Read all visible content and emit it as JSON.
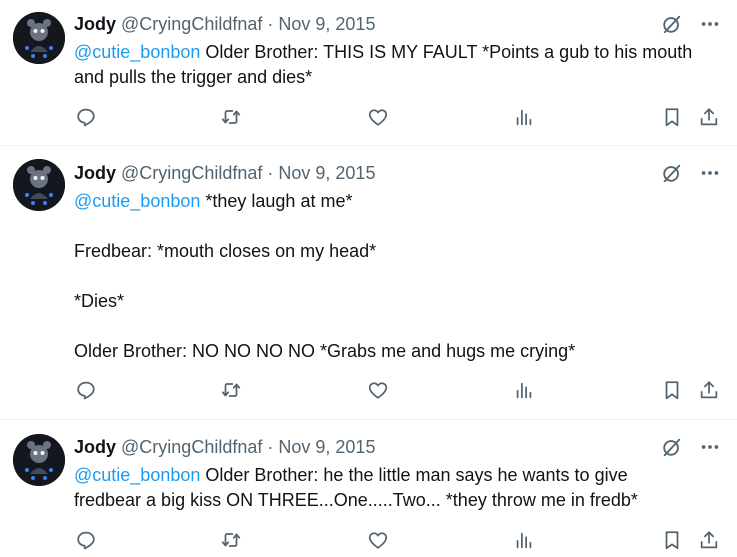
{
  "colors": {
    "text": "#0f1419",
    "muted": "#536471",
    "link": "#1d9bf0",
    "divider": "#eff3f4"
  },
  "icons": [
    "grok-icon",
    "more-icon",
    "reply-icon",
    "retweet-icon",
    "like-icon",
    "views-icon",
    "bookmark-icon",
    "share-icon"
  ],
  "tweets": [
    {
      "name": "Jody",
      "handle": "@CryingChildfnaf",
      "separator": "·",
      "date": "Nov 9, 2015",
      "mention": "@cutie_bonbon",
      "line1": " Older Brother: THIS IS MY FAULT *Points a gub to his mouth",
      "line2": "and pulls the trigger and dies*"
    },
    {
      "name": "Jody",
      "handle": "@CryingChildfnaf",
      "separator": "·",
      "date": "Nov 9, 2015",
      "mention": "@cutie_bonbon",
      "line1": " *they laugh at me*",
      "line2": "Fredbear: *mouth closes on my head*",
      "line3": "*Dies*",
      "line4": "Older Brother: NO NO NO NO *Grabs me and hugs me crying*"
    },
    {
      "name": "Jody",
      "handle": "@CryingChildfnaf",
      "separator": "·",
      "date": "Nov 9, 2015",
      "mention": "@cutie_bonbon",
      "line1": " Older Brother: he the little man says he wants to give",
      "line2": "fredbear a big kiss ON THREE...One.....Two... *they throw me in fredb*"
    }
  ]
}
